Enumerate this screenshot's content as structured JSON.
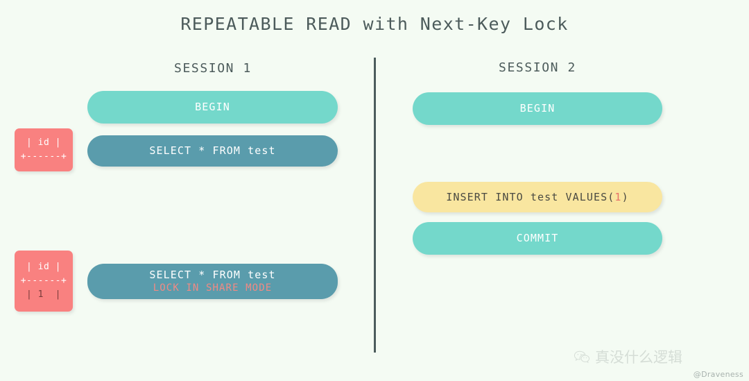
{
  "title": "REPEATABLE READ with Next-Key Lock",
  "colors": {
    "background": "#f4fbf3",
    "teal": "#74d8cb",
    "steel": "#5a9cac",
    "yellow": "#f9e6a0",
    "coral": "#f98180",
    "divider": "#4c5c5c",
    "title_text": "#4c5b5b",
    "sub_text": "#f08a84"
  },
  "sessions": [
    {
      "header": "SESSION 1",
      "statements": [
        {
          "label": "BEGIN",
          "style": "teal"
        },
        {
          "label": "SELECT * FROM test",
          "style": "steel"
        },
        {
          "label": "SELECT * FROM test",
          "sub": "LOCK IN SHARE MODE",
          "style": "steel"
        }
      ],
      "results": [
        {
          "header_row": "| id |",
          "separator": "+------+",
          "value_row": ""
        },
        {
          "header_row": "| id |",
          "separator": "+------+",
          "value_row": "| 1  |"
        }
      ]
    },
    {
      "header": "SESSION 2",
      "statements": [
        {
          "label": "BEGIN",
          "style": "teal"
        },
        {
          "label_prefix": "INSERT INTO test VALUES(",
          "label_num": "1",
          "label_suffix": ")",
          "style": "yellow"
        },
        {
          "label": "COMMIT",
          "style": "teal"
        }
      ]
    }
  ],
  "watermark": {
    "icon": "wechat-icon",
    "text": "真没什么逻辑",
    "handle": "@Draveness"
  }
}
